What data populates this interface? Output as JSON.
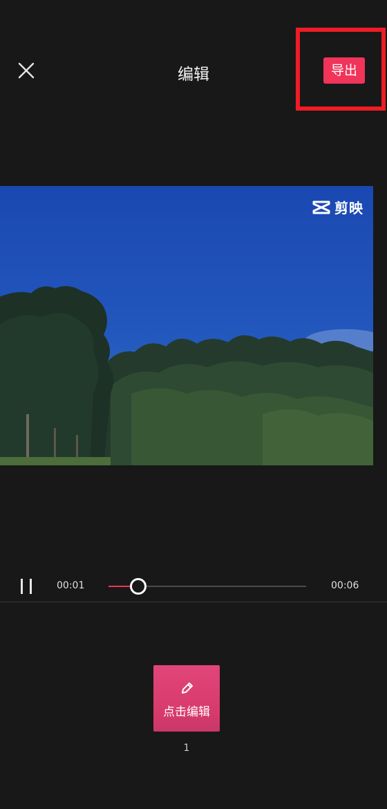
{
  "header": {
    "title": "编辑",
    "close_icon": "close-icon",
    "export_label": "导出",
    "export_color": "#f0345a",
    "highlight_color": "#ee1c25"
  },
  "video": {
    "watermark_icon": "capcut-logo-icon",
    "watermark_text": "剪映",
    "sky_color": "#1e52b8"
  },
  "player": {
    "play_state_icon": "pause-icon",
    "current_time": "00:01",
    "total_time": "00:06",
    "progress": 0.15,
    "accent_color": "#f0345a"
  },
  "clips": [
    {
      "label": "点击编辑",
      "icon": "pencil-icon",
      "index": "1"
    }
  ]
}
